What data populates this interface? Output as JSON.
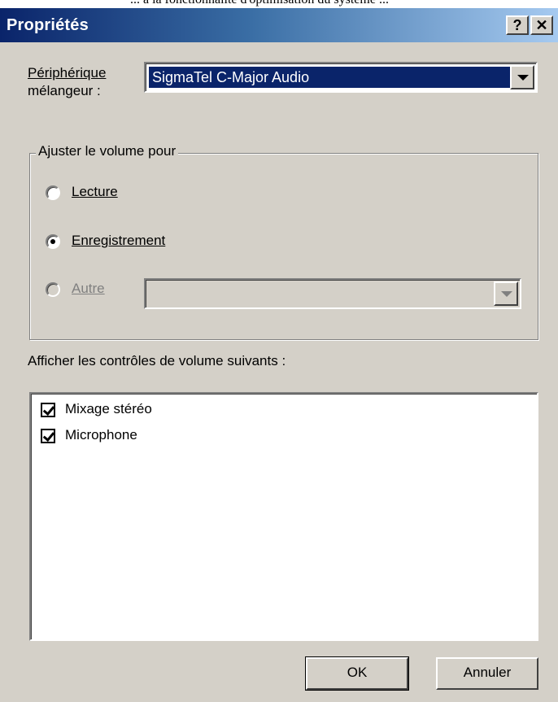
{
  "page_header_fragment": "... à la fonctionnalité d'optimisation du système ...",
  "window": {
    "title": "Propriétés",
    "help_button": "?",
    "close_button": "✕"
  },
  "mixer": {
    "label_line1": "Périphérique",
    "label_line2": "mélangeur :",
    "selected_device": "SigmaTel C-Major Audio"
  },
  "adjust_group": {
    "legend": "Ajuster le volume pour",
    "options": [
      {
        "label": "Lecture",
        "checked": false,
        "disabled": false
      },
      {
        "label": "Enregistrement",
        "checked": true,
        "disabled": false
      },
      {
        "label": "Autre",
        "checked": false,
        "disabled": true
      }
    ],
    "other_select_value": ""
  },
  "controls": {
    "label": "Afficher les contrôles de volume suivants :",
    "items": [
      {
        "label": "Mixage stéréo",
        "checked": true
      },
      {
        "label": "Microphone",
        "checked": true
      }
    ]
  },
  "buttons": {
    "ok": "OK",
    "cancel": "Annuler"
  },
  "colors": {
    "titlebar_start": "#0a246a",
    "titlebar_end": "#a6caf0",
    "dialog_face": "#d4d0c8",
    "selection": "#0a246a"
  }
}
